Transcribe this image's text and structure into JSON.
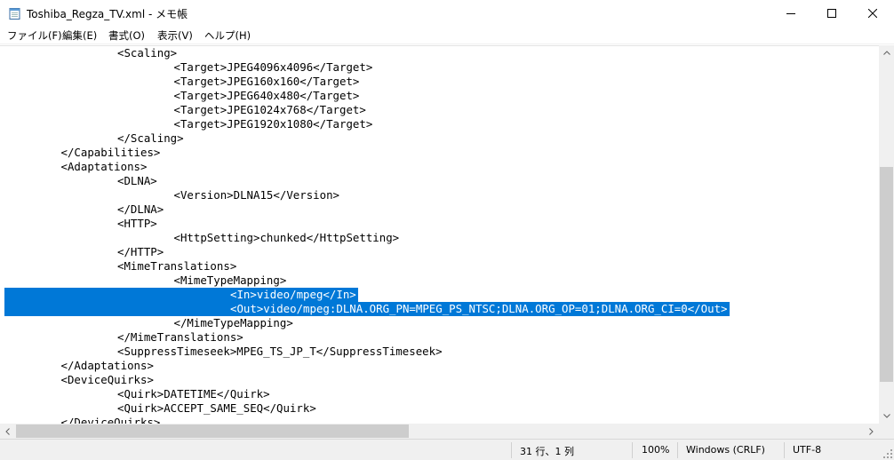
{
  "window": {
    "title": "Toshiba_Regza_TV.xml - メモ帳",
    "icon": "notepad-icon",
    "controls": [
      "minimize-icon",
      "maximize-icon",
      "close-icon"
    ]
  },
  "menu": {
    "items": [
      "ファイル(F)",
      "編集(E)",
      "書式(O)",
      "表示(V)",
      "ヘルプ(H)"
    ]
  },
  "editor": {
    "selection_color": "#0078d7",
    "lines": [
      "\t\t<Scaling>",
      "\t\t\t<Target>JPEG4096x4096</Target>",
      "\t\t\t<Target>JPEG160x160</Target>",
      "\t\t\t<Target>JPEG640x480</Target>",
      "\t\t\t<Target>JPEG1024x768</Target>",
      "\t\t\t<Target>JPEG1920x1080</Target>",
      "\t\t</Scaling>",
      "\t</Capabilities>",
      "\t<Adaptations>",
      "\t\t<DLNA>",
      "\t\t\t<Version>DLNA15</Version>",
      "\t\t</DLNA>",
      "\t\t<HTTP>",
      "\t\t\t<HttpSetting>chunked</HttpSetting>",
      "\t\t</HTTP>",
      "\t\t<MimeTranslations>",
      "\t\t\t<MimeTypeMapping>",
      "\t\t\t\t<In>video/mpeg</In>",
      "\t\t\t\t<Out>video/mpeg:DLNA.ORG_PN=MPEG_PS_NTSC;DLNA.ORG_OP=01;DLNA.ORG_CI=0</Out>",
      "\t\t\t</MimeTypeMapping>",
      "\t\t</MimeTranslations>",
      "\t\t<SuppressTimeseek>MPEG_TS_JP_T</SuppressTimeseek>",
      "\t</Adaptations>",
      "\t<DeviceQuirks>",
      "\t\t<Quirk>DATETIME</Quirk>",
      "\t\t<Quirk>ACCEPT_SAME_SEQ</Quirk>",
      "\t</DeviceQuirks>"
    ],
    "selected_lines": [
      17,
      18
    ]
  },
  "status": {
    "position": "31 行、1 列",
    "zoom": "100%",
    "line_ending": "Windows (CRLF)",
    "encoding": "UTF-8"
  }
}
